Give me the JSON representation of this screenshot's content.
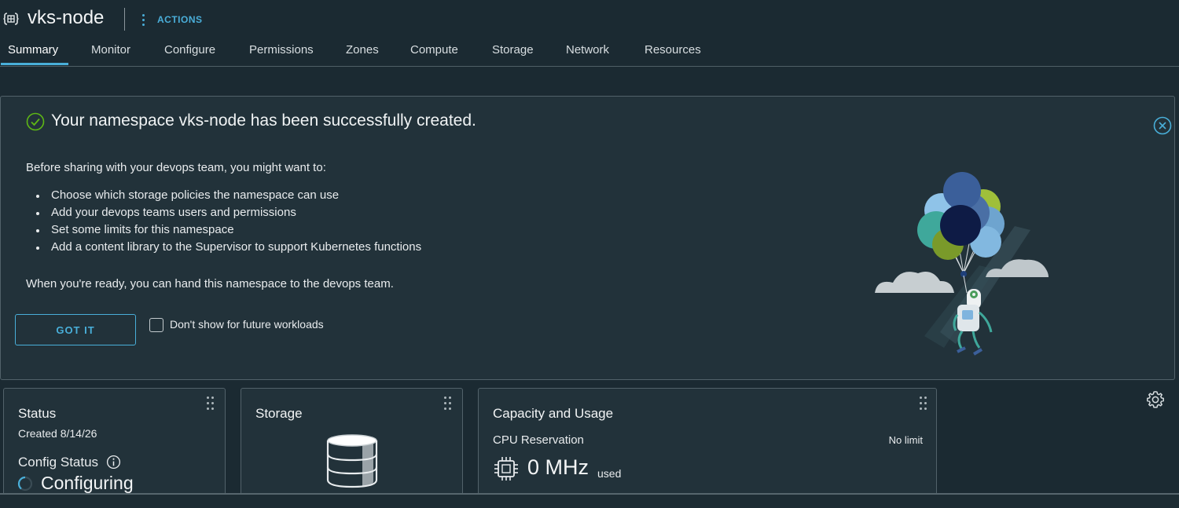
{
  "header": {
    "title": "vks-node",
    "actions_label": "ACTIONS",
    "icon": "namespace-icon"
  },
  "tabs": [
    {
      "label": "Summary",
      "active": true
    },
    {
      "label": "Monitor"
    },
    {
      "label": "Configure"
    },
    {
      "label": "Permissions"
    },
    {
      "label": "Zones"
    },
    {
      "label": "Compute"
    },
    {
      "label": "Storage"
    },
    {
      "label": "Network"
    },
    {
      "label": "Resources"
    }
  ],
  "banner": {
    "title": "Your namespace vks-node has been successfully created.",
    "intro": "Before sharing with your devops team, you might want to:",
    "items": [
      "Choose which storage policies the namespace can use",
      "Add your devops teams users and permissions",
      "Set some limits for this namespace",
      "Add a content library to the Supervisor to support Kubernetes functions"
    ],
    "ready": "When you're ready, you can hand this namespace to the devops team.",
    "button": "GOT IT",
    "checkbox_label": "Don't show for future workloads",
    "checkbox_checked": false,
    "success_color": "#5eb715",
    "accent_color": "#49afd9"
  },
  "cards": {
    "status": {
      "title": "Status",
      "created": "Created 8/14/26",
      "config_status_label": "Config Status",
      "config_status_value": "Configuring"
    },
    "storage": {
      "title": "Storage"
    },
    "capacity": {
      "title": "Capacity and Usage",
      "cpu_label": "CPU Reservation",
      "cpu_limit": "No limit",
      "cpu_value": "0 MHz",
      "cpu_used": "used"
    }
  }
}
